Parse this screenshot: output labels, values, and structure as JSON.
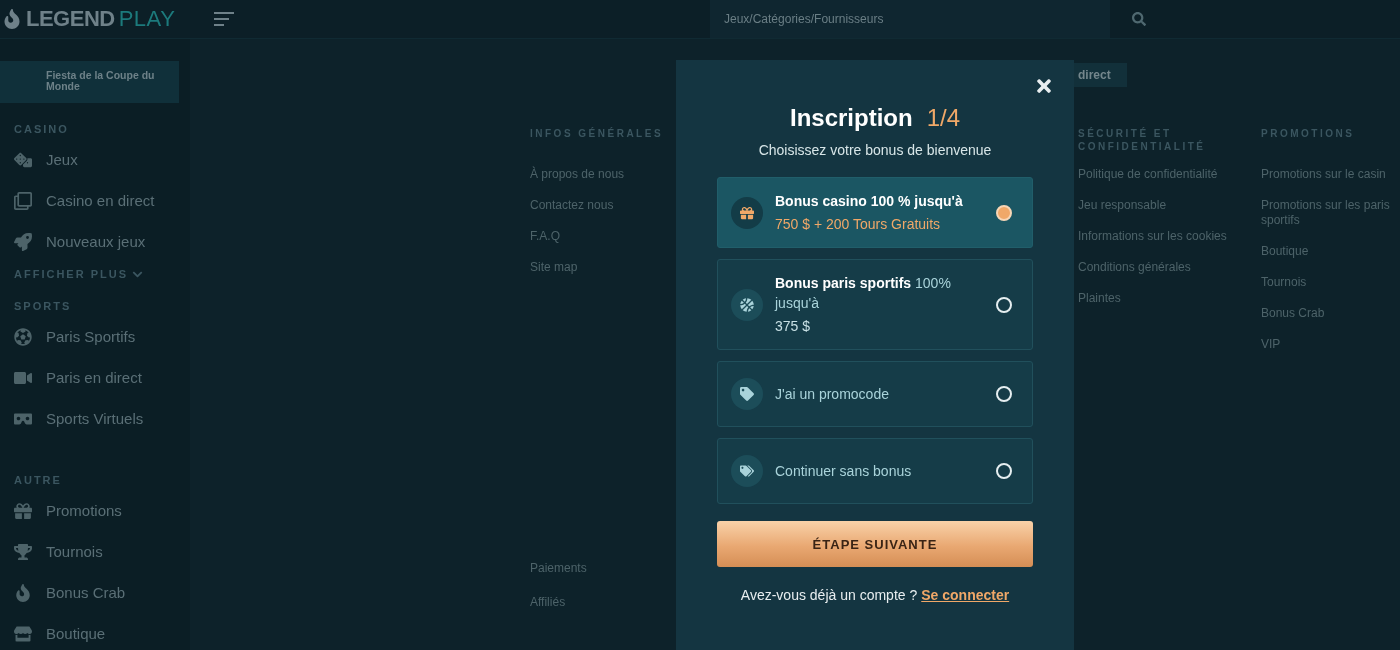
{
  "header": {
    "logo": {
      "part_1": "LEGEND",
      "part_2": "PLAY"
    },
    "search": {
      "placeholder": "Jeux/Catégories/Fournisseurs"
    }
  },
  "sidebar": {
    "banner": "Fiesta de la Coupe du Monde",
    "sections": [
      {
        "heading": "CASINO",
        "items": [
          "Jeux",
          "Casino en direct",
          "Nouveaux jeux"
        ],
        "more": "AFFICHER PLUS"
      },
      {
        "heading": "SPORTS",
        "items": [
          "Paris Sportifs",
          "Paris en direct",
          "Sports Virtuels"
        ]
      },
      {
        "heading": "AUTRE",
        "items": [
          "Promotions",
          "Tournois",
          "Bonus Crab",
          "Boutique"
        ]
      }
    ]
  },
  "top_tab": "direct",
  "footer": {
    "columns": [
      {
        "heading": "INFOS GÉNÉRALES",
        "links": [
          "À propos de nous",
          "Contactez nous",
          "F.A.Q",
          "Site map"
        ],
        "bottom_links": [
          "Paiements",
          "Affiliés"
        ]
      },
      {
        "heading": "SÉCURITÉ ET CONFIDENTIALITÉ",
        "links": [
          "Politique de confidentialité",
          "Jeu responsable",
          "Informations sur les cookies",
          "Conditions générales",
          "Plaintes"
        ]
      },
      {
        "heading": "PROMOTIONS",
        "links": [
          "Promotions sur le casin",
          "Promotions sur les paris sportifs",
          "Boutique",
          "Tournois",
          "Bonus Crab",
          "VIP"
        ]
      }
    ]
  },
  "modal": {
    "title": "Inscription",
    "step": "1/4",
    "subtitle": "Choisissez votre bonus de bienvenue",
    "options": [
      {
        "kind": "casino",
        "text": "Bonus casino 100 % jusqu'à",
        "amount": "750 $ + 200 Tours Gratuits",
        "selected": true
      },
      {
        "kind": "sport",
        "text": "**Bonus paris sportifs** 100% jusqu'à",
        "amount": "375 $",
        "selected": false
      },
      {
        "kind": "promocode",
        "text": "J'ai un promocode",
        "selected": false
      },
      {
        "kind": "none",
        "text": "Continuer sans bonus",
        "selected": false
      }
    ],
    "next_button": "ÉTAPE SUIVANTE",
    "login_prompt": "Avez-vous déjà un compte ?",
    "login_link": "Se connecter"
  }
}
